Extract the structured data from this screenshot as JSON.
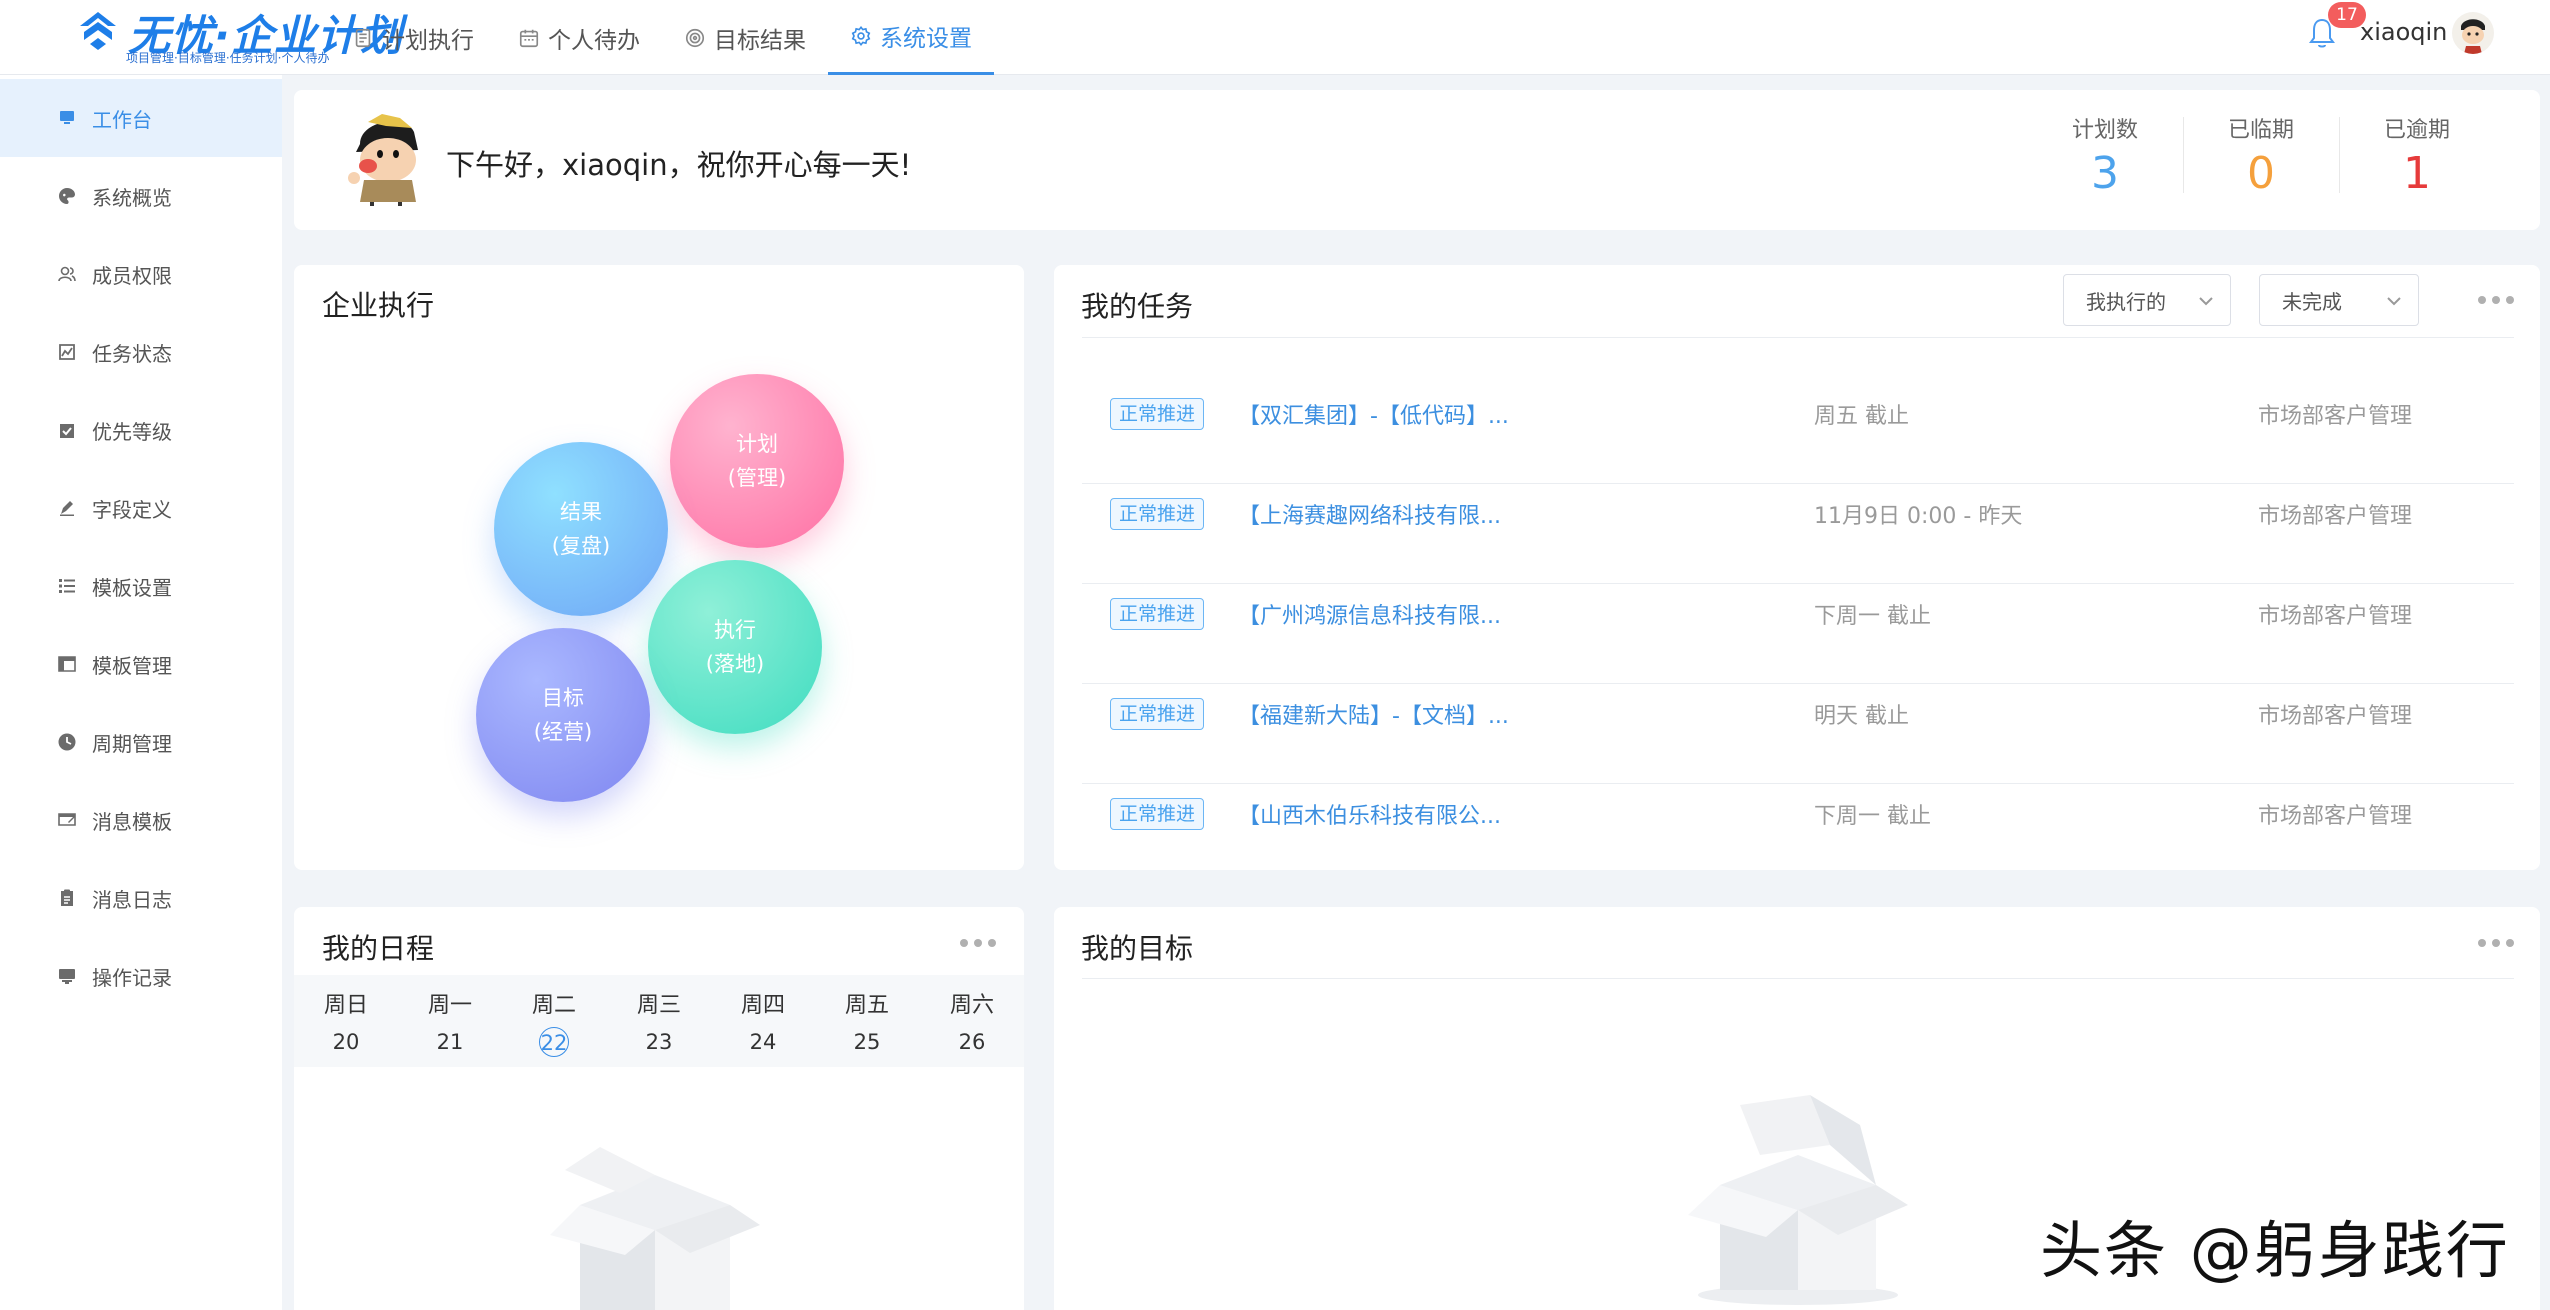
{
  "brand": {
    "title": "无忧·企业计划",
    "subtitle": "项目管理·目标管理·任务计划·个人待办"
  },
  "nav": [
    {
      "label": "计划执行",
      "icon": "document-icon"
    },
    {
      "label": "个人待办",
      "icon": "calendar-icon"
    },
    {
      "label": "目标结果",
      "icon": "target-icon"
    },
    {
      "label": "系统设置",
      "icon": "gear-icon",
      "active": true
    }
  ],
  "user": {
    "notifications": "17",
    "name": "xiaoqin"
  },
  "sidebar": {
    "items": [
      {
        "label": "工作台",
        "icon": "monitor-icon",
        "active": true
      },
      {
        "label": "系统概览",
        "icon": "palette-icon"
      },
      {
        "label": "成员权限",
        "icon": "users-icon"
      },
      {
        "label": "任务状态",
        "icon": "chart-icon"
      },
      {
        "label": "优先等级",
        "icon": "calendar-check-icon"
      },
      {
        "label": "字段定义",
        "icon": "pen-icon"
      },
      {
        "label": "模板设置",
        "icon": "list-icon"
      },
      {
        "label": "模板管理",
        "icon": "table-icon"
      },
      {
        "label": "周期管理",
        "icon": "clock-icon"
      },
      {
        "label": "消息模板",
        "icon": "message-icon"
      },
      {
        "label": "消息日志",
        "icon": "clipboard-icon"
      },
      {
        "label": "操作记录",
        "icon": "record-icon"
      }
    ]
  },
  "greeting": {
    "text": "下午好，xiaoqin，祝你开心每一天!"
  },
  "stats": [
    {
      "label": "计划数",
      "value": "3",
      "color": "#4da3ec"
    },
    {
      "label": "已临期",
      "value": "0",
      "color": "#f5a03c"
    },
    {
      "label": "已逾期",
      "value": "1",
      "color": "#e63b3b"
    }
  ],
  "enterprise": {
    "title": "企业执行",
    "bubbles": [
      {
        "line1": "计划",
        "line2": "(管理)"
      },
      {
        "line1": "结果",
        "line2": "(复盘)"
      },
      {
        "line1": "执行",
        "line2": "(落地)"
      },
      {
        "line1": "目标",
        "line2": "(经营)"
      }
    ]
  },
  "tasks": {
    "title": "我的任务",
    "filter1": "我执行的",
    "filter2": "未完成",
    "rows": [
      {
        "tag": "正常推进",
        "name": "【双汇集团】-【低代码】...",
        "due": "周五 截止",
        "dept": "市场部客户管理"
      },
      {
        "tag": "正常推进",
        "name": "【上海赛趣网络科技有限...",
        "due": "11月9日 0:00 - 昨天",
        "dept": "市场部客户管理"
      },
      {
        "tag": "正常推进",
        "name": "【广州鸿源信息科技有限...",
        "due": "下周一 截止",
        "dept": "市场部客户管理"
      },
      {
        "tag": "正常推进",
        "name": "【福建新大陆】-【文档】...",
        "due": "明天 截止",
        "dept": "市场部客户管理"
      },
      {
        "tag": "正常推进",
        "name": "【山西木伯乐科技有限公...",
        "due": "下周一 截止",
        "dept": "市场部客户管理"
      }
    ]
  },
  "schedule": {
    "title": "我的日程",
    "days": [
      {
        "weekday": "周日",
        "date": "20"
      },
      {
        "weekday": "周一",
        "date": "21"
      },
      {
        "weekday": "周二",
        "date": "22",
        "today": true
      },
      {
        "weekday": "周三",
        "date": "23"
      },
      {
        "weekday": "周四",
        "date": "24"
      },
      {
        "weekday": "周五",
        "date": "25"
      },
      {
        "weekday": "周六",
        "date": "26"
      }
    ]
  },
  "goals": {
    "title": "我的目标"
  },
  "watermark": "头条 @躬身践行"
}
